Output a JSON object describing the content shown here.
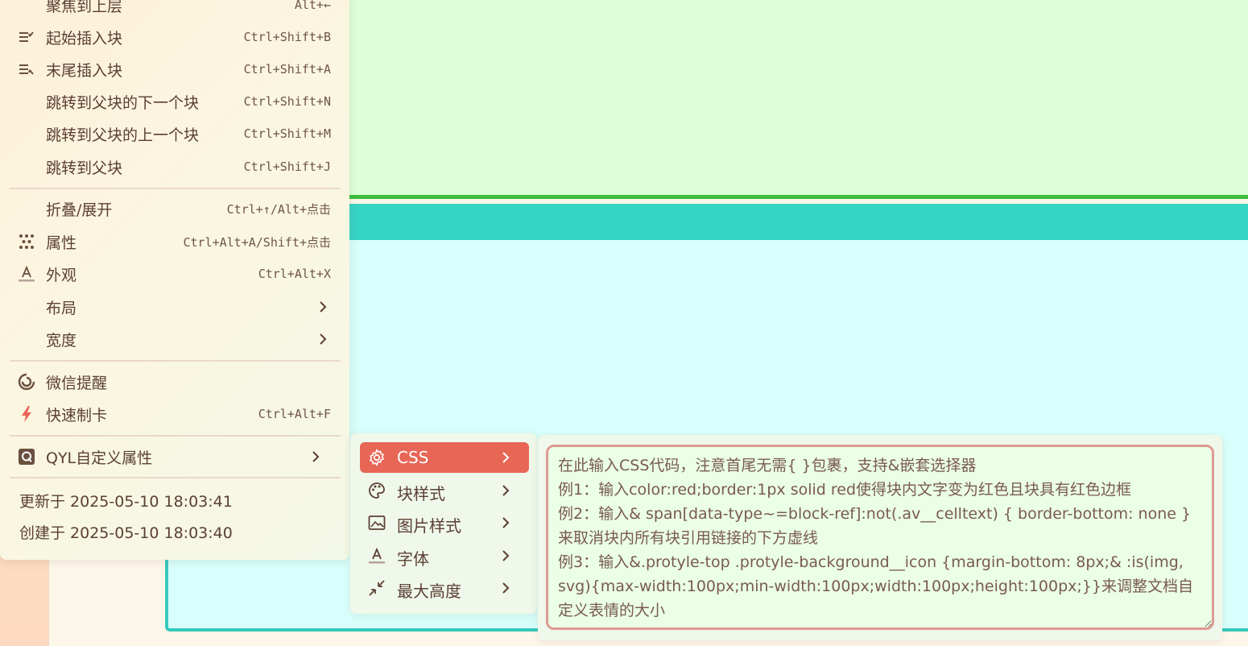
{
  "main_menu": {
    "items": [
      {
        "label": "聚焦到上层",
        "shortcut": "Alt+←",
        "icon": ""
      },
      {
        "label": "起始插入块",
        "shortcut": "Ctrl+Shift+B",
        "icon": "insert-before-icon"
      },
      {
        "label": "末尾插入块",
        "shortcut": "Ctrl+Shift+A",
        "icon": "insert-after-icon"
      },
      {
        "label": "跳转到父块的下一个块",
        "shortcut": "Ctrl+Shift+N",
        "icon": ""
      },
      {
        "label": "跳转到父块的上一个块",
        "shortcut": "Ctrl+Shift+M",
        "icon": ""
      },
      {
        "label": "跳转到父块",
        "shortcut": "Ctrl+Shift+J",
        "icon": ""
      },
      {
        "label": "折叠/展开",
        "shortcut": "Ctrl+↑/Alt+点击",
        "icon": ""
      },
      {
        "label": "属性",
        "shortcut": "Ctrl+Alt+A/Shift+点击",
        "icon": "attributes-icon"
      },
      {
        "label": "外观",
        "shortcut": "Ctrl+Alt+X",
        "icon": "appearance-icon"
      },
      {
        "label": "布局",
        "shortcut": "",
        "icon": ""
      },
      {
        "label": "宽度",
        "shortcut": "",
        "icon": ""
      },
      {
        "label": "微信提醒",
        "shortcut": "",
        "icon": "wechat-reminder-icon"
      },
      {
        "label": "快速制卡",
        "shortcut": "Ctrl+Alt+F",
        "icon": "lightning-icon"
      },
      {
        "label": "QYL自定义属性",
        "shortcut": "",
        "icon": "q-badge-icon"
      }
    ],
    "updated": "更新于 2025-05-10 18:03:41",
    "created": "创建于 2025-05-10 18:03:40"
  },
  "submenu": {
    "items": [
      {
        "label": "CSS",
        "icon": "gear-icon",
        "active": true
      },
      {
        "label": "块样式",
        "icon": "palette-icon",
        "active": false
      },
      {
        "label": "图片样式",
        "icon": "image-icon",
        "active": false
      },
      {
        "label": "字体",
        "icon": "font-icon",
        "active": false
      },
      {
        "label": "最大高度",
        "icon": "shrink-icon",
        "active": false
      }
    ]
  },
  "css_editor": {
    "placeholder": "在此输入CSS代码，注意首尾无需{ }包裹，支持&嵌套选择器\n例1：输入color:red;border:1px solid red使得块内文字变为红色且块具有红色边框\n例2：输入& span[data-type~=block-ref]:not(.av__celltext) { border-bottom: none }来取消块内所有块引用链接的下方虚线\n例3：输入&.protyle-top .protyle-background__icon {margin-bottom: 8px;& :is(img, svg){max-width:100px;min-width:100px;width:100px;height:100px;}}来调整文档自定义表情的大小"
  },
  "colors": {
    "accent": "#e86656",
    "text": "#5b3f33",
    "block_green": "#dcffd8",
    "block_cyan": "#d8fffb",
    "teal": "#36d4c4"
  }
}
